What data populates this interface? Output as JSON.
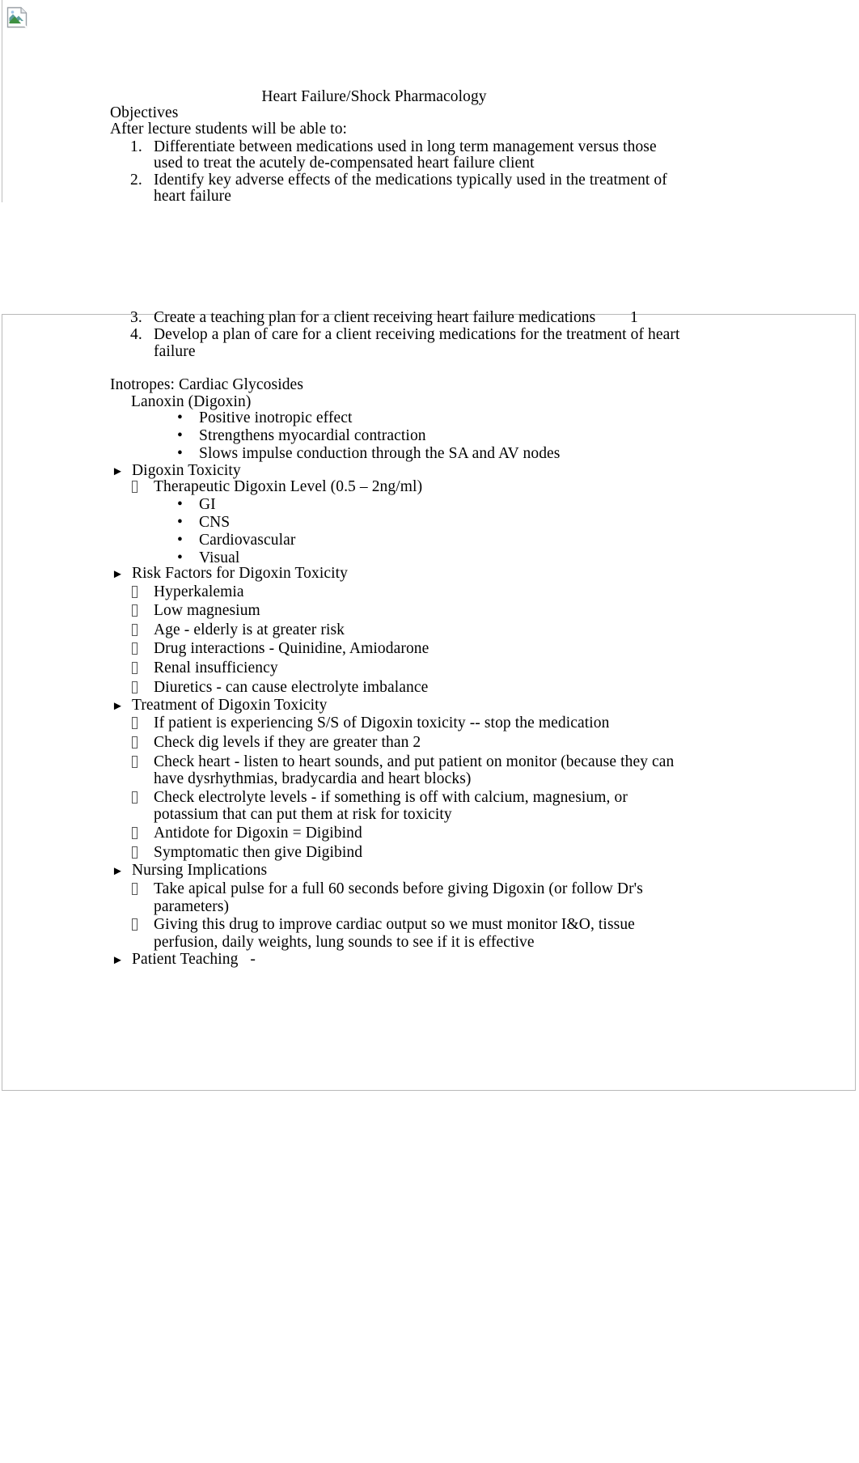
{
  "document": {
    "title": "Heart Failure/Shock Pharmacology",
    "page_number": "1",
    "broken_image_alt": ""
  },
  "objectives": {
    "heading": "Objectives",
    "intro": "After lecture students will be able to:",
    "items": [
      {
        "number": "1.",
        "lines": [
          "Differentiate between medications used in long term management versus those",
          "used to treat the acutely de-compensated heart failure client"
        ]
      },
      {
        "number": "2.",
        "lines": [
          "Identify key adverse effects of the medications typically used in the treatment of",
          "heart failure"
        ]
      },
      {
        "number": "3.",
        "lines": [
          "Create a teaching plan for a client receiving heart failure medications"
        ]
      },
      {
        "number": "4.",
        "lines": [
          "Develop a plan of care for a client receiving medications for the treatment of heart",
          "failure"
        ]
      }
    ]
  },
  "inotropes": {
    "heading": "Inotropes: Cardiac Glycosides",
    "drug": "Lanoxin (Digoxin)",
    "drug_effects": [
      "Positive inotropic effect",
      "Strengthens myocardial contraction",
      "Slows impulse conduction through the SA and AV nodes"
    ]
  },
  "digoxin_toxicity": {
    "heading": "Digoxin Toxicity",
    "therapeutic_level": "Therapeutic Digoxin Level (0.5 – 2ng/ml)",
    "signs": [
      "GI",
      "CNS",
      "Cardiovascular",
      "Visual"
    ]
  },
  "risk_factors": {
    "heading": "Risk Factors for Digoxin Toxicity",
    "items": [
      "Hyperkalemia",
      "Low magnesium",
      "Age - elderly is at greater risk",
      "Drug interactions - Quinidine, Amiodarone",
      "Renal insufficiency",
      "Diuretics - can cause electrolyte imbalance"
    ]
  },
  "treatment": {
    "heading": "Treatment of Digoxin Toxicity",
    "items": [
      {
        "lines": [
          "If patient is experiencing S/S of Digoxin toxicity -- stop the medication"
        ]
      },
      {
        "lines": [
          "Check dig levels if they are greater than 2"
        ]
      },
      {
        "lines": [
          "Check heart - listen to heart sounds, and put patient on monitor (because they can",
          "have dysrhythmias, bradycardia and heart blocks)"
        ]
      },
      {
        "lines": [
          "Check electrolyte levels - if something is off with calcium, magnesium, or",
          "potassium that can put them at risk for toxicity"
        ]
      },
      {
        "lines": [
          "Antidote for Digoxin = Digibind"
        ]
      },
      {
        "lines": [
          "Symptomatic then give Digibind"
        ]
      }
    ]
  },
  "nursing_implications": {
    "heading": "Nursing Implications",
    "items": [
      {
        "lines": [
          "Take apical pulse for a full 60 seconds before giving Digoxin (or follow Dr's",
          "parameters)"
        ]
      },
      {
        "lines": [
          "Giving this drug to improve cardiac output so we must monitor I&O, tissue",
          "perfusion, daily weights, lung sounds to see if it is effective"
        ]
      }
    ]
  },
  "patient_teaching": {
    "heading": "Patient Teaching   -"
  },
  "glyphs": {
    "dot": "•",
    "arrow": "►"
  }
}
